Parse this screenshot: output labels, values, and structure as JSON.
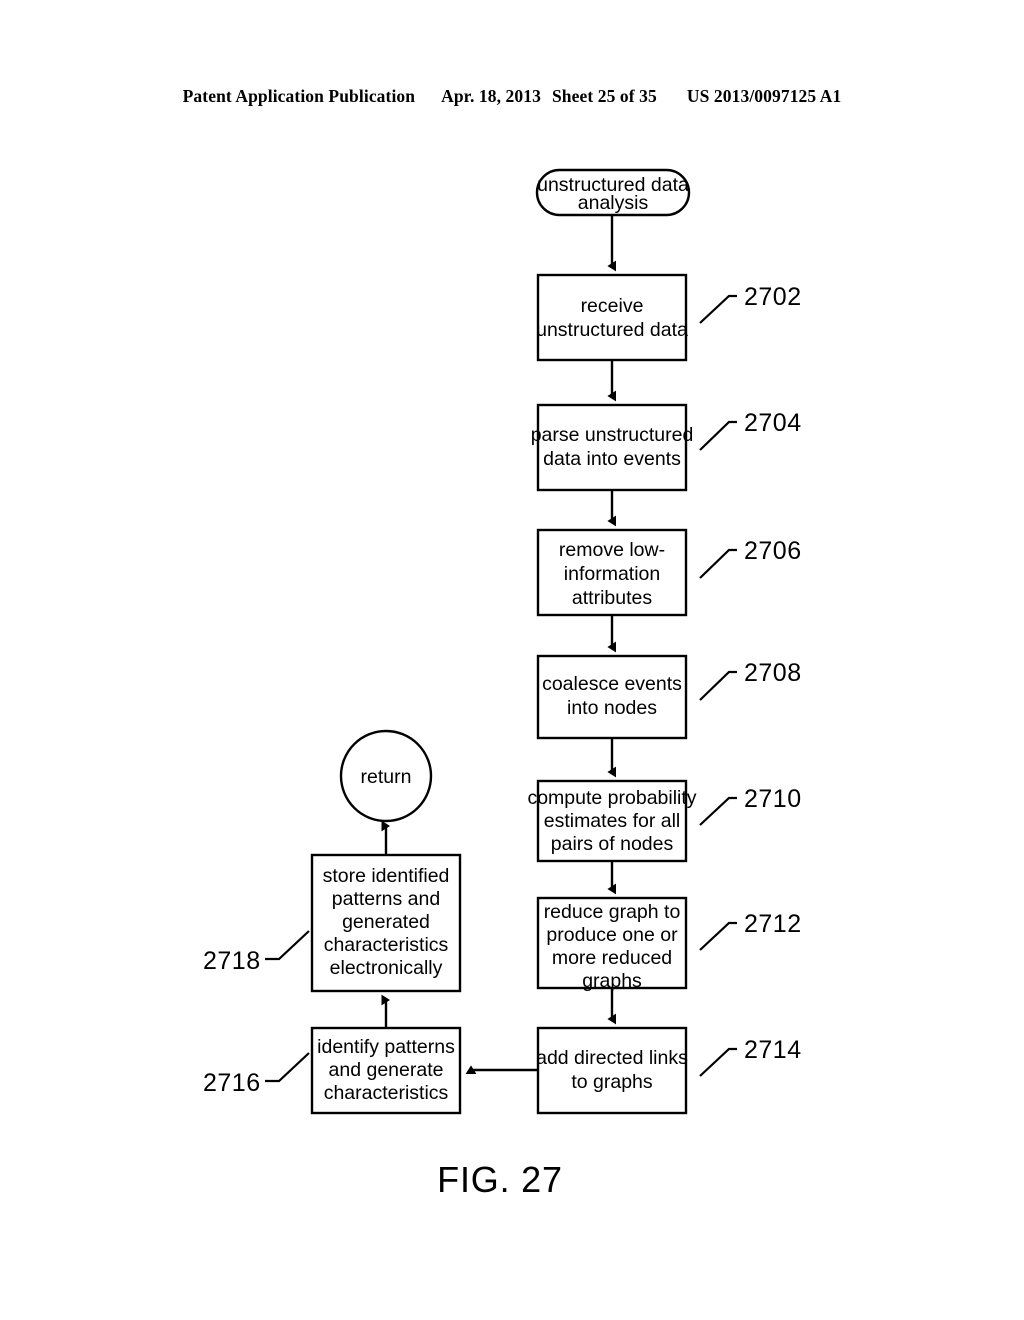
{
  "page": {
    "header": {
      "publication": "Patent Application Publication",
      "date": "Apr. 18, 2013",
      "sheet": "Sheet 25 of 35",
      "patent_number": "US 2013/0097125 A1"
    },
    "figure_caption": "FIG. 27"
  },
  "flowchart": {
    "title": "unstructured data analysis",
    "start_terminal": {
      "label_line1": "unstructured data",
      "label_line2": "analysis"
    },
    "end_terminal": {
      "label": "return"
    },
    "steps": [
      {
        "ref": "2702",
        "lines": [
          "receive",
          "unstructured data"
        ]
      },
      {
        "ref": "2704",
        "lines": [
          "parse unstructured",
          "data into events"
        ]
      },
      {
        "ref": "2706",
        "lines": [
          "remove low-",
          "information",
          "attributes"
        ]
      },
      {
        "ref": "2708",
        "lines": [
          "coalesce events",
          "into nodes"
        ]
      },
      {
        "ref": "2710",
        "lines": [
          "compute probability",
          "estimates for all",
          "pairs of nodes"
        ]
      },
      {
        "ref": "2712",
        "lines": [
          "reduce graph to",
          "produce one or",
          "more reduced",
          "graphs"
        ]
      },
      {
        "ref": "2714",
        "lines": [
          "add directed links",
          "to graphs"
        ]
      },
      {
        "ref": "2716",
        "lines": [
          "identify patterns",
          "and generate",
          "characteristics"
        ]
      },
      {
        "ref": "2718",
        "lines": [
          "store identified",
          "patterns and",
          "generated",
          "characteristics",
          "electronically"
        ]
      }
    ],
    "colors": {
      "stroke": "#000000",
      "fill": "#ffffff"
    }
  }
}
